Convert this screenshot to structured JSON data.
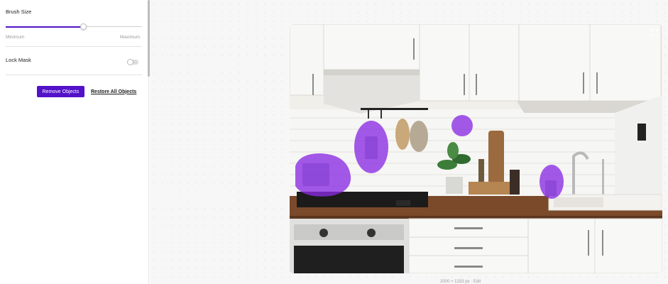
{
  "sidebar": {
    "brush_size_label": "Brush Size",
    "brush_size_value": 0.57,
    "range_min_label": "Minimum",
    "range_max_label": "Maximum",
    "lock_mask_label": "Lock Mask",
    "lock_mask_enabled": false,
    "remove_button_label": "Remove Objects",
    "restore_button_label": "Restore All Objects"
  },
  "canvas": {
    "expand_icon": "expand-icon",
    "caption": "2000 × 1333 px · Edit"
  },
  "colors": {
    "accent": "#5312c9",
    "mask": "#8a2be2"
  }
}
